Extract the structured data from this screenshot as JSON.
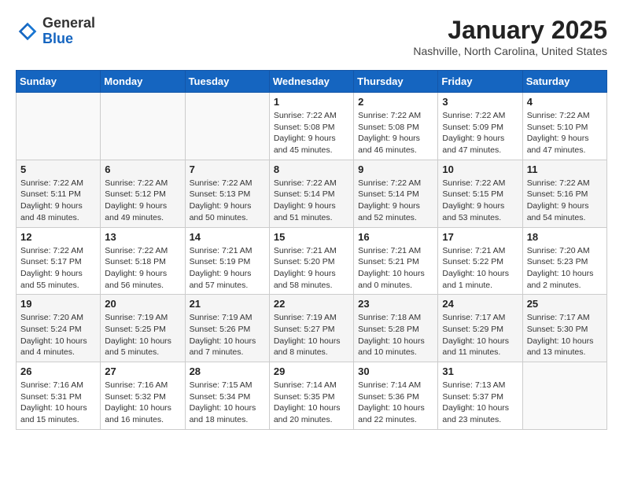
{
  "header": {
    "logo_general": "General",
    "logo_blue": "Blue",
    "title": "January 2025",
    "location": "Nashville, North Carolina, United States"
  },
  "weekdays": [
    "Sunday",
    "Monday",
    "Tuesday",
    "Wednesday",
    "Thursday",
    "Friday",
    "Saturday"
  ],
  "weeks": [
    [
      {
        "day": "",
        "info": ""
      },
      {
        "day": "",
        "info": ""
      },
      {
        "day": "",
        "info": ""
      },
      {
        "day": "1",
        "info": "Sunrise: 7:22 AM\nSunset: 5:08 PM\nDaylight: 9 hours\nand 45 minutes."
      },
      {
        "day": "2",
        "info": "Sunrise: 7:22 AM\nSunset: 5:08 PM\nDaylight: 9 hours\nand 46 minutes."
      },
      {
        "day": "3",
        "info": "Sunrise: 7:22 AM\nSunset: 5:09 PM\nDaylight: 9 hours\nand 47 minutes."
      },
      {
        "day": "4",
        "info": "Sunrise: 7:22 AM\nSunset: 5:10 PM\nDaylight: 9 hours\nand 47 minutes."
      }
    ],
    [
      {
        "day": "5",
        "info": "Sunrise: 7:22 AM\nSunset: 5:11 PM\nDaylight: 9 hours\nand 48 minutes."
      },
      {
        "day": "6",
        "info": "Sunrise: 7:22 AM\nSunset: 5:12 PM\nDaylight: 9 hours\nand 49 minutes."
      },
      {
        "day": "7",
        "info": "Sunrise: 7:22 AM\nSunset: 5:13 PM\nDaylight: 9 hours\nand 50 minutes."
      },
      {
        "day": "8",
        "info": "Sunrise: 7:22 AM\nSunset: 5:14 PM\nDaylight: 9 hours\nand 51 minutes."
      },
      {
        "day": "9",
        "info": "Sunrise: 7:22 AM\nSunset: 5:14 PM\nDaylight: 9 hours\nand 52 minutes."
      },
      {
        "day": "10",
        "info": "Sunrise: 7:22 AM\nSunset: 5:15 PM\nDaylight: 9 hours\nand 53 minutes."
      },
      {
        "day": "11",
        "info": "Sunrise: 7:22 AM\nSunset: 5:16 PM\nDaylight: 9 hours\nand 54 minutes."
      }
    ],
    [
      {
        "day": "12",
        "info": "Sunrise: 7:22 AM\nSunset: 5:17 PM\nDaylight: 9 hours\nand 55 minutes."
      },
      {
        "day": "13",
        "info": "Sunrise: 7:22 AM\nSunset: 5:18 PM\nDaylight: 9 hours\nand 56 minutes."
      },
      {
        "day": "14",
        "info": "Sunrise: 7:21 AM\nSunset: 5:19 PM\nDaylight: 9 hours\nand 57 minutes."
      },
      {
        "day": "15",
        "info": "Sunrise: 7:21 AM\nSunset: 5:20 PM\nDaylight: 9 hours\nand 58 minutes."
      },
      {
        "day": "16",
        "info": "Sunrise: 7:21 AM\nSunset: 5:21 PM\nDaylight: 10 hours\nand 0 minutes."
      },
      {
        "day": "17",
        "info": "Sunrise: 7:21 AM\nSunset: 5:22 PM\nDaylight: 10 hours\nand 1 minute."
      },
      {
        "day": "18",
        "info": "Sunrise: 7:20 AM\nSunset: 5:23 PM\nDaylight: 10 hours\nand 2 minutes."
      }
    ],
    [
      {
        "day": "19",
        "info": "Sunrise: 7:20 AM\nSunset: 5:24 PM\nDaylight: 10 hours\nand 4 minutes."
      },
      {
        "day": "20",
        "info": "Sunrise: 7:19 AM\nSunset: 5:25 PM\nDaylight: 10 hours\nand 5 minutes."
      },
      {
        "day": "21",
        "info": "Sunrise: 7:19 AM\nSunset: 5:26 PM\nDaylight: 10 hours\nand 7 minutes."
      },
      {
        "day": "22",
        "info": "Sunrise: 7:19 AM\nSunset: 5:27 PM\nDaylight: 10 hours\nand 8 minutes."
      },
      {
        "day": "23",
        "info": "Sunrise: 7:18 AM\nSunset: 5:28 PM\nDaylight: 10 hours\nand 10 minutes."
      },
      {
        "day": "24",
        "info": "Sunrise: 7:17 AM\nSunset: 5:29 PM\nDaylight: 10 hours\nand 11 minutes."
      },
      {
        "day": "25",
        "info": "Sunrise: 7:17 AM\nSunset: 5:30 PM\nDaylight: 10 hours\nand 13 minutes."
      }
    ],
    [
      {
        "day": "26",
        "info": "Sunrise: 7:16 AM\nSunset: 5:31 PM\nDaylight: 10 hours\nand 15 minutes."
      },
      {
        "day": "27",
        "info": "Sunrise: 7:16 AM\nSunset: 5:32 PM\nDaylight: 10 hours\nand 16 minutes."
      },
      {
        "day": "28",
        "info": "Sunrise: 7:15 AM\nSunset: 5:34 PM\nDaylight: 10 hours\nand 18 minutes."
      },
      {
        "day": "29",
        "info": "Sunrise: 7:14 AM\nSunset: 5:35 PM\nDaylight: 10 hours\nand 20 minutes."
      },
      {
        "day": "30",
        "info": "Sunrise: 7:14 AM\nSunset: 5:36 PM\nDaylight: 10 hours\nand 22 minutes."
      },
      {
        "day": "31",
        "info": "Sunrise: 7:13 AM\nSunset: 5:37 PM\nDaylight: 10 hours\nand 23 minutes."
      },
      {
        "day": "",
        "info": ""
      }
    ]
  ]
}
